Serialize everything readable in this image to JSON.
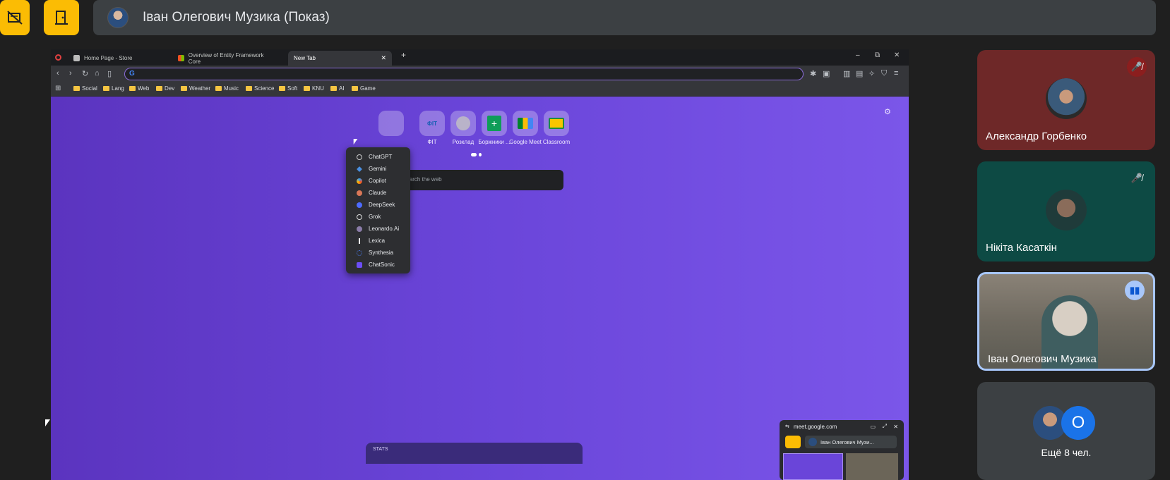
{
  "top_bar": {
    "stop_present_icon": "no-present-icon",
    "door_icon": "door-icon",
    "presenter_name": "Іван Олегович Музика (Показ)"
  },
  "browser": {
    "tabs": [
      {
        "label": "Home Page - Store"
      },
      {
        "label": "Overview of Entity Framework Core"
      },
      {
        "label": "New Tab"
      }
    ],
    "new_tab_symbol": "+",
    "window_controls": {
      "minimize": "–",
      "restore": "⧉",
      "close": "✕"
    },
    "bookmarks": [
      "Social",
      "Lang",
      "Web",
      "Dev",
      "Weather",
      "Music",
      "Science",
      "Soft",
      "KNU",
      "AI",
      "Game"
    ],
    "ai_menu": [
      "ChatGPT",
      "Gemini",
      "Copilot",
      "Claude",
      "DeepSeek",
      "Grok",
      "Leonardo.Ai",
      "Lexica",
      "Synthesia",
      "ChatSonic"
    ],
    "shortcuts": [
      {
        "label": "ФІТ",
        "tile_text": "ФІТ"
      },
      {
        "label": "Розклад"
      },
      {
        "label": "Боржники ..."
      },
      {
        "label": "Google Meet"
      },
      {
        "label": "Classroom"
      }
    ],
    "search_placeholder": "Search the web",
    "stats_label": "STATS",
    "pip": {
      "url": "meet.google.com",
      "name": "Іван Олегович Музи..."
    }
  },
  "participants": [
    {
      "name": "Александр Горбенко",
      "muted": true,
      "bg": "#6e2828"
    },
    {
      "name": "Нікіта Касаткін",
      "muted": true,
      "bg": "#0d4a44"
    },
    {
      "name": "Іван Олегович Музика",
      "speaking": true
    },
    {
      "name": "Ещё 8 чел.",
      "avatar_letter": "О"
    }
  ],
  "colors": {
    "accent_yellow": "#fbbc04",
    "page_purple": "#6a45d9",
    "blue_avatar": "#1a73e8"
  }
}
